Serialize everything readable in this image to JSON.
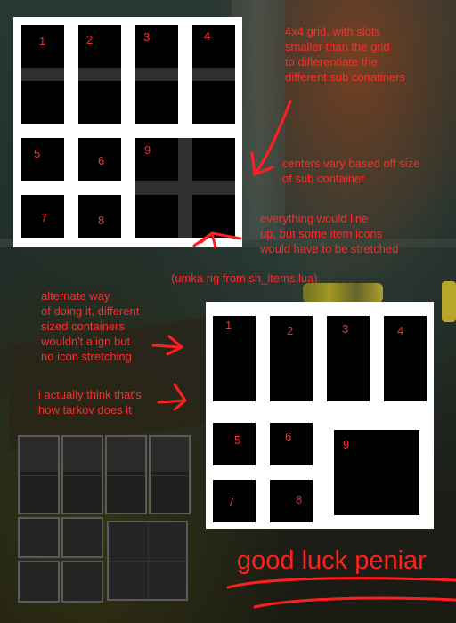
{
  "panel1": {
    "slots": [
      "1",
      "2",
      "3",
      "4",
      "5",
      "6",
      "7",
      "8",
      "9"
    ]
  },
  "panel2": {
    "slots": [
      "1",
      "2",
      "3",
      "4",
      "5",
      "6",
      "7",
      "8",
      "9"
    ]
  },
  "notes": {
    "grid_note": "4x4 grid, with slots\nsmaller than the grid\nto differentiate the\ndifferent sub conatiners",
    "centers_note": "centers vary based off size\nof sub container",
    "line_up_note": "everything would line\nup, but some item icons\nwould have to be stretched",
    "rig_note": "(umka rig from sh_items.lua)",
    "alternate_note": "alternate way\nof doing it, different\nsized containers\nwouldn't align but\nno icon stretching",
    "tarkov_note": "i actually think that's\nhow tarkov does it",
    "good_luck": "good luck peniar"
  },
  "colors": {
    "annotation": "#ff2b2b",
    "slot": "#000000",
    "panel": "#ffffff"
  }
}
